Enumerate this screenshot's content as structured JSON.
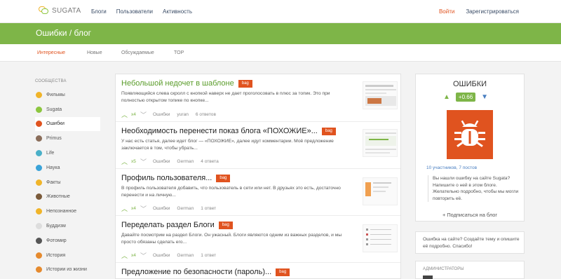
{
  "header": {
    "logo_text": "SUGATA",
    "nav": [
      "Блоги",
      "Пользователи",
      "Активность"
    ],
    "login": "Войти",
    "register": "Зарегистрироваться"
  },
  "banner": {
    "title": "Ошибки / блог"
  },
  "subtabs": [
    "Интересные",
    "Новые",
    "Обсуждаемые",
    "TOP"
  ],
  "sidebar": {
    "title": "Сообщества",
    "items": [
      {
        "label": "Фильмы",
        "color": "#f0b429"
      },
      {
        "label": "Sugata",
        "color": "#8cc63f"
      },
      {
        "label": "Ошибки",
        "color": "#e0531f"
      },
      {
        "label": "Primus",
        "color": "#8a6d5a"
      },
      {
        "label": "Life",
        "color": "#4ab0c8"
      },
      {
        "label": "Наука",
        "color": "#3aa3d8"
      },
      {
        "label": "Факты",
        "color": "#f0b429"
      },
      {
        "label": "Животные",
        "color": "#7a5a3a"
      },
      {
        "label": "Непознанное",
        "color": "#f0b429"
      },
      {
        "label": "Буддизм",
        "color": "#dddddd"
      },
      {
        "label": "Фотомир",
        "color": "#555555"
      },
      {
        "label": "История",
        "color": "#e58a2e"
      },
      {
        "label": "Истории из жизни",
        "color": "#e58a2e"
      }
    ]
  },
  "topics": [
    {
      "title": "Небольшой недочет в шаблоне",
      "tag": "bag",
      "excerpt": "Появляющийся слева скролл с кнопкой наверх не дает проголосовать в плюс за топик. Это при полностью открытом топике по кнопке...",
      "votes": "x4",
      "blog": "Ошибки",
      "author": "yuran",
      "comments": "6 ответов"
    },
    {
      "title": "Необходимость перенести показ блога «ПОХОЖИЕ»...",
      "tag": "bag",
      "excerpt": "У нас есть статья, далее идет блог — «ПОХОЖИЕ», далее идут комментарии. Моё предложение заключается в том, чтобы убрать...",
      "votes": "x5",
      "blog": "Ошибки",
      "author": "German",
      "comments": "4 ответа"
    },
    {
      "title": "Профиль пользователя...",
      "tag": "bag",
      "excerpt": "В профиль пользователя добавить, что пользователь в сети или нет. В друзьях это есть, достаточно перенести и на личную...",
      "votes": "x4",
      "blog": "Ошибки",
      "author": "German",
      "comments": "1 ответ"
    },
    {
      "title": "Переделать раздел Блоги",
      "tag": "bag",
      "excerpt": "Давайте посмотрим на раздел Блоги. Он ужасный. Блоги являются одним из важных разделов, и мы просто обязаны сделать его...",
      "votes": "x4",
      "blog": "Ошибки",
      "author": "German",
      "comments": "1 ответ"
    },
    {
      "title": "Предложение по безопасности (пароль)...",
      "tag": "bag"
    }
  ],
  "blog_box": {
    "title": "ОШИБКИ",
    "rating": "+0.66",
    "stats": "10 участников, 7 постов",
    "description": "Вы нашли ошибку на сайте Sugata? Напишите о ней в этом блоге. Желательно подробно, чтобы мы могли повторить её.",
    "subscribe": "+ Подписаться на блог"
  },
  "report_box": {
    "text": "Ошибка на сайте? Создайте тему и опишите её подробно. Спасибо!"
  },
  "admins_box": {
    "title": "Администраторы"
  }
}
